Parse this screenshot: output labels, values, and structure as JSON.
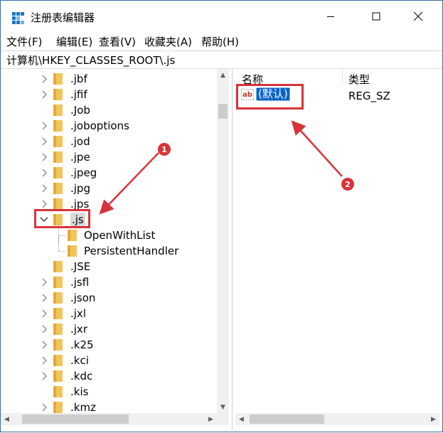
{
  "window": {
    "title": "注册表编辑器",
    "icon": "regedit-icon"
  },
  "menu": [
    {
      "label": "文件(F)"
    },
    {
      "label": "编辑(E)"
    },
    {
      "label": "查看(V)"
    },
    {
      "label": "收藏夹(A)"
    },
    {
      "label": "帮助(H)"
    }
  ],
  "address": {
    "path": "计算机\\HKEY_CLASSES_ROOT\\.js"
  },
  "tree": {
    "items": [
      {
        "label": ".jbf",
        "expander": "collapsed"
      },
      {
        "label": ".jfif",
        "expander": "collapsed"
      },
      {
        "label": ".Job",
        "expander": "none"
      },
      {
        "label": ".joboptions",
        "expander": "collapsed"
      },
      {
        "label": ".jod",
        "expander": "collapsed"
      },
      {
        "label": ".jpe",
        "expander": "collapsed"
      },
      {
        "label": ".jpeg",
        "expander": "collapsed"
      },
      {
        "label": ".jpg",
        "expander": "collapsed"
      },
      {
        "label": ".jps",
        "expander": "collapsed"
      },
      {
        "label": ".js",
        "expander": "expanded",
        "selected": true
      },
      {
        "label": "OpenWithList",
        "expander": "none",
        "child": true
      },
      {
        "label": "PersistentHandler",
        "expander": "none",
        "child": true
      },
      {
        "label": ".JSE",
        "expander": "none"
      },
      {
        "label": ".jsfl",
        "expander": "collapsed"
      },
      {
        "label": ".json",
        "expander": "collapsed"
      },
      {
        "label": ".jxl",
        "expander": "collapsed"
      },
      {
        "label": ".jxr",
        "expander": "collapsed"
      },
      {
        "label": ".k25",
        "expander": "collapsed"
      },
      {
        "label": ".kci",
        "expander": "collapsed"
      },
      {
        "label": ".kdc",
        "expander": "collapsed"
      },
      {
        "label": ".kis",
        "expander": "none"
      },
      {
        "label": ".kmz",
        "expander": "collapsed"
      }
    ]
  },
  "list": {
    "columns": [
      {
        "label": "名称"
      },
      {
        "label": "类型"
      }
    ],
    "rows": [
      {
        "name": "(默认)",
        "type": "REG_SZ",
        "icon": "string-value-icon"
      }
    ]
  },
  "annotations": [
    {
      "number": "1",
      "target": "tree-item-js"
    },
    {
      "number": "2",
      "target": "default-value-row"
    }
  ],
  "colors": {
    "annotation": "#d8333a",
    "selection": "#0a64c8",
    "folder": "#f2c55c"
  }
}
